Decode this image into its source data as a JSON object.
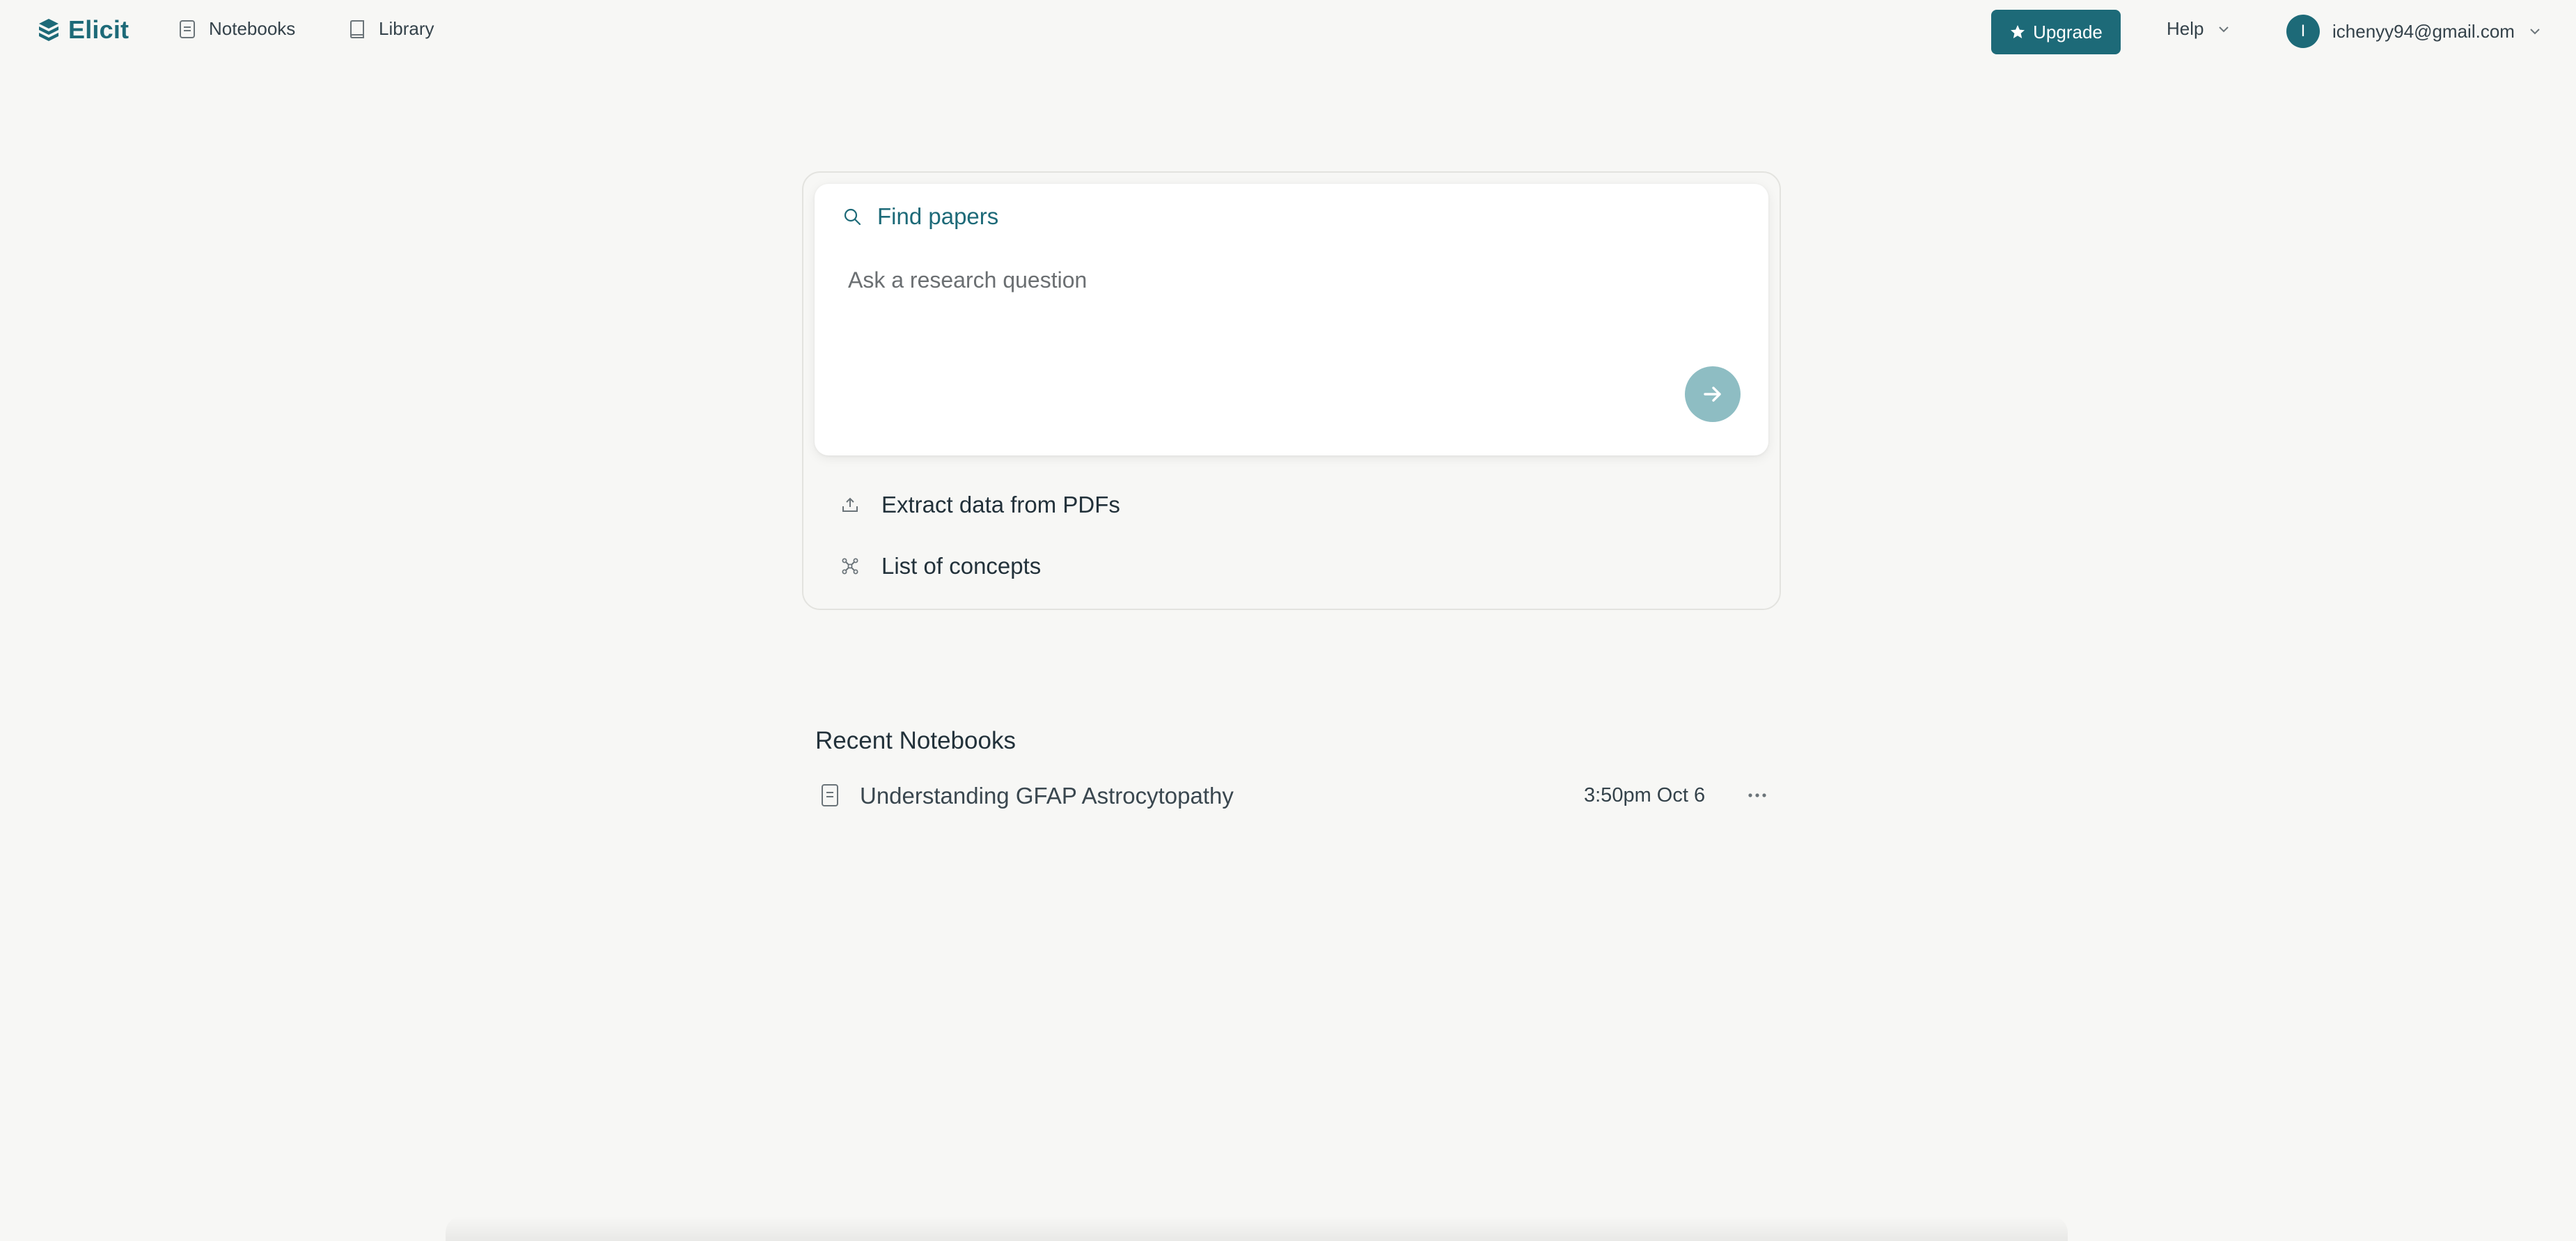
{
  "app": {
    "name": "Elicit",
    "brand_color": "#1d6a78"
  },
  "nav": {
    "items": [
      {
        "label": "Notebooks",
        "icon": "notebook-icon"
      },
      {
        "label": "Library",
        "icon": "book-icon"
      }
    ],
    "upgrade_label": "Upgrade",
    "upgrade_icon": "star-icon",
    "help_label": "Help",
    "account": {
      "avatar_initial": "I",
      "email": "ichenyy94@gmail.com"
    }
  },
  "search": {
    "mode_label": "Find papers",
    "mode_icon": "search-icon",
    "placeholder": "Ask a research question",
    "value": "",
    "submit_icon": "arrow-right-icon",
    "submit_color": "#8ebdc3"
  },
  "options": [
    {
      "label": "Extract data from PDFs",
      "icon": "upload-icon"
    },
    {
      "label": "List of concepts",
      "icon": "concepts-icon"
    }
  ],
  "recent": {
    "heading": "Recent Notebooks",
    "items": [
      {
        "title": "Understanding GFAP Astrocytopathy",
        "time": "3:50pm Oct 6",
        "icon": "notebook-icon",
        "menu_icon": "more-icon"
      }
    ]
  }
}
